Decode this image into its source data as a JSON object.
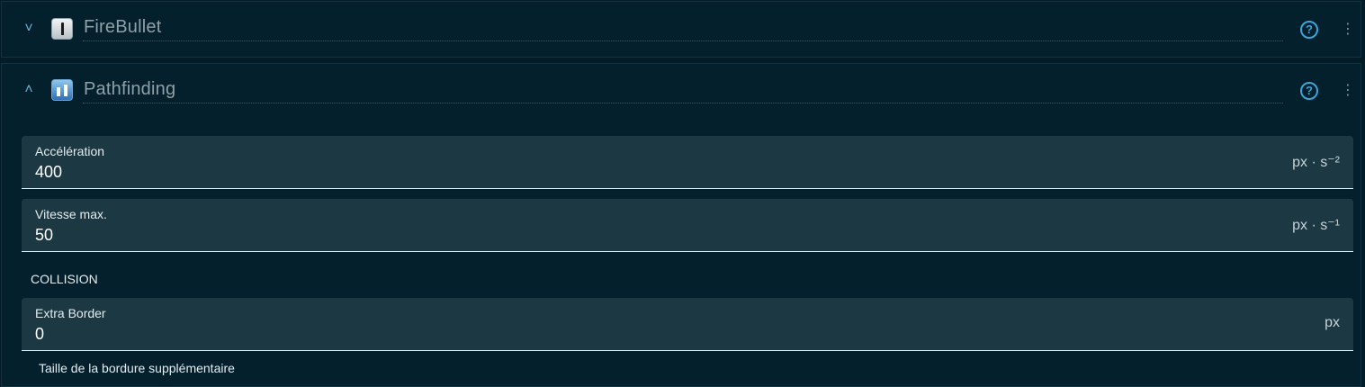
{
  "behaviors": [
    {
      "name": "FireBullet",
      "expanded": false,
      "icon": "bullet-icon"
    },
    {
      "name": "Pathfinding",
      "expanded": true,
      "icon": "pathfinding-icon"
    }
  ],
  "icons": {
    "collapsed_chevron": "˅",
    "expanded_chevron": "˄",
    "help": "?",
    "more": "⋮"
  },
  "pathfinding": {
    "fields": [
      {
        "label": "Accélération",
        "value": "400",
        "unit": "px · s⁻²"
      },
      {
        "label": "Vitesse max.",
        "value": "50",
        "unit": "px · s⁻¹"
      }
    ],
    "collision_section": "COLLISION",
    "collision_fields": [
      {
        "label": "Extra Border",
        "value": "0",
        "unit": "px",
        "helper": "Taille de la bordure supplémentaire"
      }
    ]
  },
  "colors": {
    "background": "#031c27",
    "accent": "#3aa6d8",
    "field_bg": "#1c3843"
  }
}
